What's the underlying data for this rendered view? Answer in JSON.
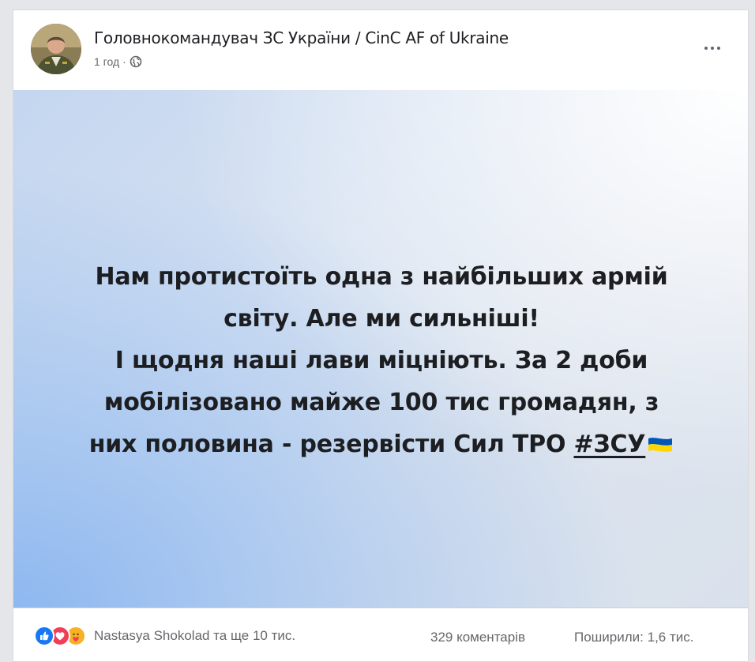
{
  "post": {
    "author": "Головнокомандувач ЗС України / CinC AF of Ukraine",
    "time": "1 год",
    "separator": "·",
    "audience_icon": "globe-icon",
    "more_icon": "more-dots-icon",
    "text_lines": [
      "Нам протистоїть одна з найбільших армій",
      "світу. Але ми сильніші!",
      "І щодня наші лави міцніють. За 2 доби",
      "мобілізовано майже 100 тис громадян, з"
    ],
    "last_line_prefix": "них половина - резервісти Сил ТРО ",
    "hashtag": "#ЗСУ",
    "flag_icon": "ukraine-flag-icon",
    "colors": {
      "flag_blue": "#0057b7",
      "flag_yellow": "#ffd700",
      "background_blue": "#8eb8f0"
    }
  },
  "footer": {
    "reactions": [
      "like-icon",
      "love-icon",
      "care-icon"
    ],
    "reactors": "Nastasya Shokolad та ще 10 тис.",
    "comments": "329 коментарів",
    "shares": "Поширили: 1,6 тис."
  }
}
